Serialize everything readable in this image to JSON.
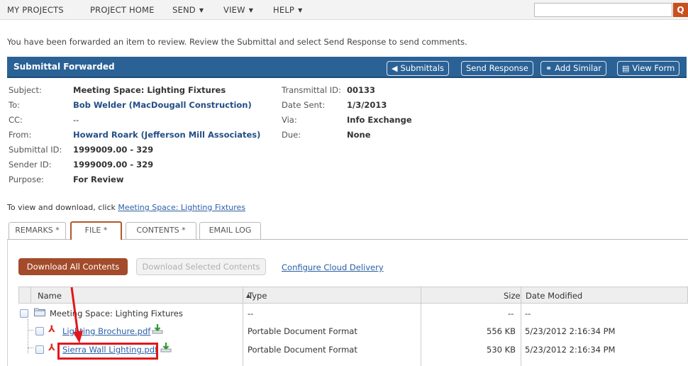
{
  "nav": {
    "items": [
      "MY PROJECTS",
      "PROJECT HOME",
      "SEND",
      "VIEW",
      "HELP"
    ],
    "search_placeholder": "",
    "search_button": "Q"
  },
  "intro_text": "You have been forwarded an item to review. Review the Submittal and select Send Response to send comments.",
  "header": {
    "title": "Submittal Forwarded",
    "buttons": {
      "submittals": "Submittals",
      "send_response": "Send Response",
      "add_similar": "Add Similar",
      "view_form": "View Form"
    }
  },
  "details": {
    "subject_label": "Subject:",
    "subject": "Meeting Space: Lighting Fixtures",
    "to_label": "To:",
    "to": "Bob Welder (MacDougall Construction)",
    "cc_label": "CC:",
    "cc": "--",
    "from_label": "From:",
    "from": "Howard Roark (Jefferson Mill Associates)",
    "submittal_id_label": "Submittal ID:",
    "submittal_id": "1999009.00 - 329",
    "sender_id_label": "Sender ID:",
    "sender_id": "1999009.00 - 329",
    "purpose_label": "Purpose:",
    "purpose": "For Review",
    "transmittal_id_label": "Transmittal ID:",
    "transmittal_id": "00133",
    "date_sent_label": "Date Sent:",
    "date_sent": "1/3/2013",
    "via_label": "Via:",
    "via": "Info Exchange",
    "due_label": "Due:",
    "due": "None"
  },
  "view_line": {
    "prefix": "To view and download, click ",
    "link": "Meeting Space: Lighting Fixtures"
  },
  "tabs": [
    "REMARKS *",
    "FILE *",
    "CONTENTS *",
    "EMAIL LOG"
  ],
  "active_tab": "FILE *",
  "actions": {
    "download_all": "Download All Contents",
    "download_selected": "Download Selected Contents",
    "configure_cloud": "Configure Cloud Delivery"
  },
  "table": {
    "headers": {
      "name": "Name",
      "type": "Type",
      "size": "Size",
      "date": "Date Modified"
    },
    "rows": [
      {
        "name": "Meeting Space: Lighting Fixtures",
        "type": "--",
        "size": "--",
        "date": "--",
        "kind": "folder-icon"
      },
      {
        "name": "Lighting Brochure.pdf",
        "type": "Portable Document Format",
        "size": "556 KB",
        "date": "5/23/2012 2:16:34 PM",
        "kind": "pdf-icon"
      },
      {
        "name": "Sierra Wall Lighting.pdf",
        "type": "Portable Document Format",
        "size": "530 KB",
        "date": "5/23/2012 2:16:34 PM",
        "kind": "pdf-icon"
      }
    ]
  },
  "colors": {
    "header_bar": "#2b6296",
    "download_all": "#a34b2a",
    "active_tab_border": "#b2562c",
    "highlight": "#e3161b",
    "link": "#2b5fa6"
  }
}
